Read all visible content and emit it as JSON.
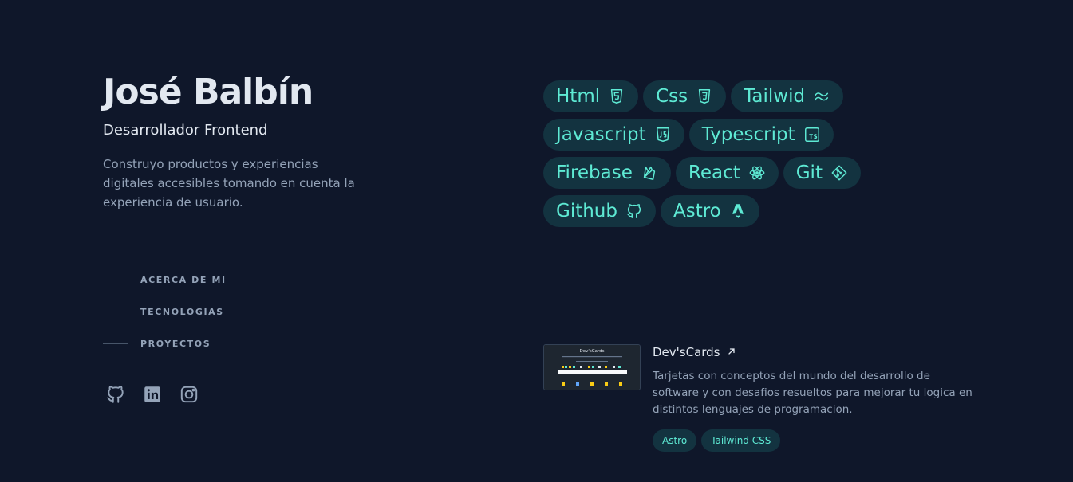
{
  "profile": {
    "name": "José Balbín",
    "role": "Desarrollador Frontend",
    "bio": "Construyo productos y experiencias digitales accesibles tomando en cuenta la experiencia de usuario."
  },
  "nav": {
    "items": [
      {
        "label": "ACERCA DE MI"
      },
      {
        "label": "TECNOLOGIAS"
      },
      {
        "label": "PROYECTOS"
      }
    ]
  },
  "social": {
    "icons": [
      "github-icon",
      "linkedin-icon",
      "instagram-icon"
    ]
  },
  "technologies": {
    "rows": [
      [
        {
          "label": "Html",
          "icon": "html5-icon"
        },
        {
          "label": "Css",
          "icon": "css3-icon"
        },
        {
          "label": "Tailwid",
          "icon": "tailwind-icon"
        }
      ],
      [
        {
          "label": "Javascript",
          "icon": "javascript-icon"
        },
        {
          "label": "Typescript",
          "icon": "typescript-icon"
        }
      ],
      [
        {
          "label": "Firebase",
          "icon": "firebase-icon"
        },
        {
          "label": "React",
          "icon": "react-icon"
        },
        {
          "label": "Git",
          "icon": "git-icon"
        }
      ],
      [
        {
          "label": "Github",
          "icon": "github-icon"
        },
        {
          "label": "Astro",
          "icon": "astro-icon"
        }
      ]
    ]
  },
  "project": {
    "title": "Dev'sCards",
    "description": "Tarjetas con conceptos del mundo del desarrollo de software y con desafios resueltos para mejorar tu logica en distintos lenguajes de programacion.",
    "tags": [
      "Astro",
      "Tailwind CSS"
    ],
    "thumbnail_title": "Dev'sCards"
  },
  "colors": {
    "background": "#0f172a",
    "accent": "#5eead4",
    "chip_bg": "#133340",
    "heading": "#e2e8f0",
    "muted": "#94a3b8"
  }
}
